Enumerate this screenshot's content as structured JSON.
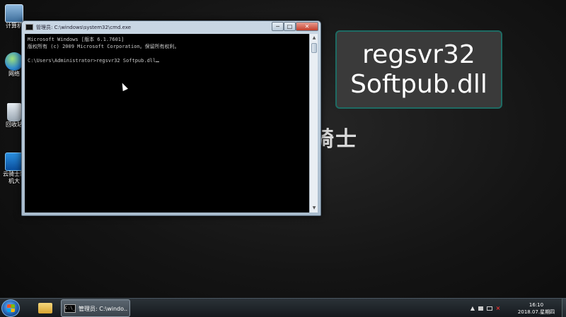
{
  "desktop": {
    "icons": [
      {
        "label": "计算机",
        "icon": "computer-icon"
      },
      {
        "label": "网络",
        "icon": "network-icon"
      },
      {
        "label": "回收站",
        "icon": "recycle-bin-icon"
      },
      {
        "label": "云骑士装机大师.exe",
        "icon": "app-icon"
      }
    ],
    "watermark": "骑士"
  },
  "cmd_window": {
    "title": "管理员: C:\\windows\\system32\\cmd.exe",
    "lines": [
      "Microsoft Windows [版本 6.1.7601]",
      "版权所有 (c) 2009 Microsoft Corporation。保留所有权利。",
      "",
      "C:\\Users\\Administrator>regsvr32 Softpub.dll"
    ],
    "buttons": {
      "minimize": "─",
      "maximize": "□",
      "close": "✕"
    }
  },
  "caption": {
    "line1": "regsvr32",
    "line2": "Softpub.dll"
  },
  "taskbar": {
    "cmd_task_label": "管理员: C:\\windo...",
    "cmd_task_icon_text": "C:\\_",
    "tray_arrow": "▲",
    "volume_glyph": "×",
    "clock_time": "16:10",
    "clock_date": "2018.07.星期四"
  }
}
